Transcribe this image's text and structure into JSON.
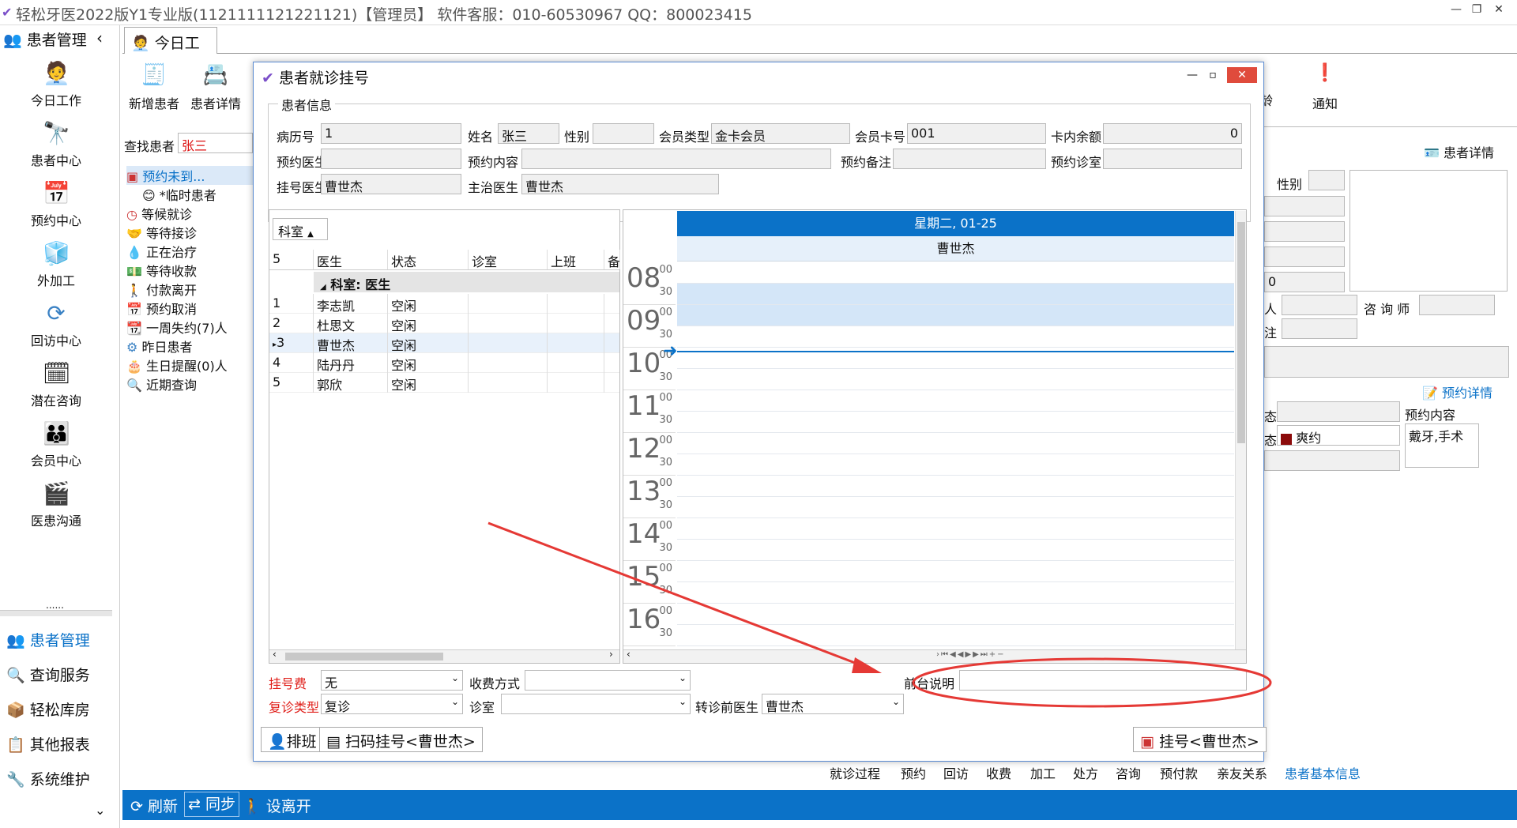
{
  "window": {
    "title": "轻松牙医2022版Y1专业版(112111112122112​1)【管理员】   软件客服：010-60530967 QQ：800023415"
  },
  "sidebar": {
    "header": "患者管理",
    "collapse_glyph": "‹",
    "big_items": [
      {
        "label": "今日工作",
        "icon": "person-desk-icon"
      },
      {
        "label": "患者中心",
        "icon": "binoculars-icon"
      },
      {
        "label": "预约中心",
        "icon": "calendar-icon"
      },
      {
        "label": "外加工",
        "icon": "cubes-icon"
      },
      {
        "label": "回访中心",
        "icon": "refresh-icon"
      },
      {
        "label": "潜在咨询",
        "icon": "person-calendar-icon"
      },
      {
        "label": "会员中心",
        "icon": "group-icon"
      },
      {
        "label": "医患沟通",
        "icon": "clapper-icon"
      }
    ],
    "dots": "......",
    "bottom_items": [
      "患者管理",
      "查询服务",
      "轻松库房",
      "其他报表",
      "系统维护"
    ]
  },
  "tabs": [
    {
      "label": "今日工作"
    }
  ],
  "toolbar": {
    "new_patient": "新增患者",
    "patient_detail": "患者详情",
    "notify": "通知",
    "partial_label": "龄"
  },
  "search": {
    "label": "查找患者",
    "value": "张三"
  },
  "tree": [
    "预约未到...",
    "*临时患者",
    "等候就诊",
    "等待接诊",
    "正在治疗",
    "等待收款",
    "付款离开",
    "预约取消",
    "一周失约(7)人",
    "昨日患者",
    "生日提醒(0)人",
    "近期查询"
  ],
  "dialog": {
    "title": "患者就诊挂号",
    "patient_info_legend": "患者信息",
    "fields": {
      "record_no_label": "病历号",
      "record_no": "1",
      "name_label": "姓名",
      "name": "张三",
      "gender_label": "性别",
      "gender": "",
      "member_type_label": "会员类型",
      "member_type": "金卡会员",
      "card_no_label": "会员卡号",
      "card_no": "001",
      "balance_label": "卡内余额",
      "balance": "0",
      "appt_doctor_label": "预约医生",
      "appt_doctor": "",
      "appt_content_label": "预约内容",
      "appt_content": "",
      "appt_note_label": "预约备注",
      "appt_note": "",
      "appt_room_label": "预约诊室",
      "appt_room": "",
      "reg_doctor_label": "挂号医生",
      "reg_doctor": "曹世杰",
      "main_doctor_label": "主治医生",
      "main_doctor": "曹世杰"
    },
    "grid": {
      "filter": "科室",
      "headers": [
        "5",
        "医生",
        "状态",
        "诊室",
        "上班",
        "备"
      ],
      "group": "科室: 医生",
      "rows": [
        {
          "n": "1",
          "doctor": "李志凯",
          "status": "空闲"
        },
        {
          "n": "2",
          "doctor": "杜思文",
          "status": "空闲"
        },
        {
          "n": "3",
          "doctor": "曹世杰",
          "status": "空闲"
        },
        {
          "n": "4",
          "doctor": "陆丹丹",
          "status": "空闲"
        },
        {
          "n": "5",
          "doctor": "郭欣",
          "status": "空闲"
        }
      ]
    },
    "calendar": {
      "day_header": "星期二, 01-25",
      "resource": "曹世杰",
      "hours": [
        "08",
        "09",
        "10",
        "11",
        "12",
        "13",
        "14",
        "15",
        "16"
      ],
      "min00": "00",
      "min30": "30"
    },
    "bottom": {
      "fee_label": "挂号费",
      "fee": "无",
      "pay_label": "收费方式",
      "pay": "",
      "front_note_label": "前台说明",
      "front_note": "",
      "revisit_label": "复诊类型",
      "revisit": "复诊",
      "room_label": "诊室",
      "room": "",
      "transfer_label": "转诊前医生",
      "transfer": "曹世杰"
    },
    "buttons": {
      "schedule": "排班",
      "scan": "扫码挂号<曹世杰>",
      "register": "挂号<曹世杰>"
    }
  },
  "right": {
    "patient_detail": "患者详情",
    "gender_label": "性别",
    "value_0": "0",
    "counselor_label": "咨 询 师",
    "person_label": "人",
    "note_label": "注",
    "appt_detail": "预约详情",
    "state_label": "态",
    "appt_content_label": "预约内容",
    "status_value": "爽约",
    "appt_content_value": "戴牙,手术"
  },
  "bottom_tabs": [
    "就诊过程",
    "预约",
    "回访",
    "收费",
    "加工",
    "处方",
    "咨询",
    "预付款",
    "亲友关系",
    "患者基本信息"
  ],
  "statusbar": {
    "refresh": "刷新",
    "sync": "同步",
    "away": "设离开"
  },
  "colors": {
    "accent": "#0b72c8",
    "required": "#e0201b",
    "annotation": "#e53935"
  }
}
